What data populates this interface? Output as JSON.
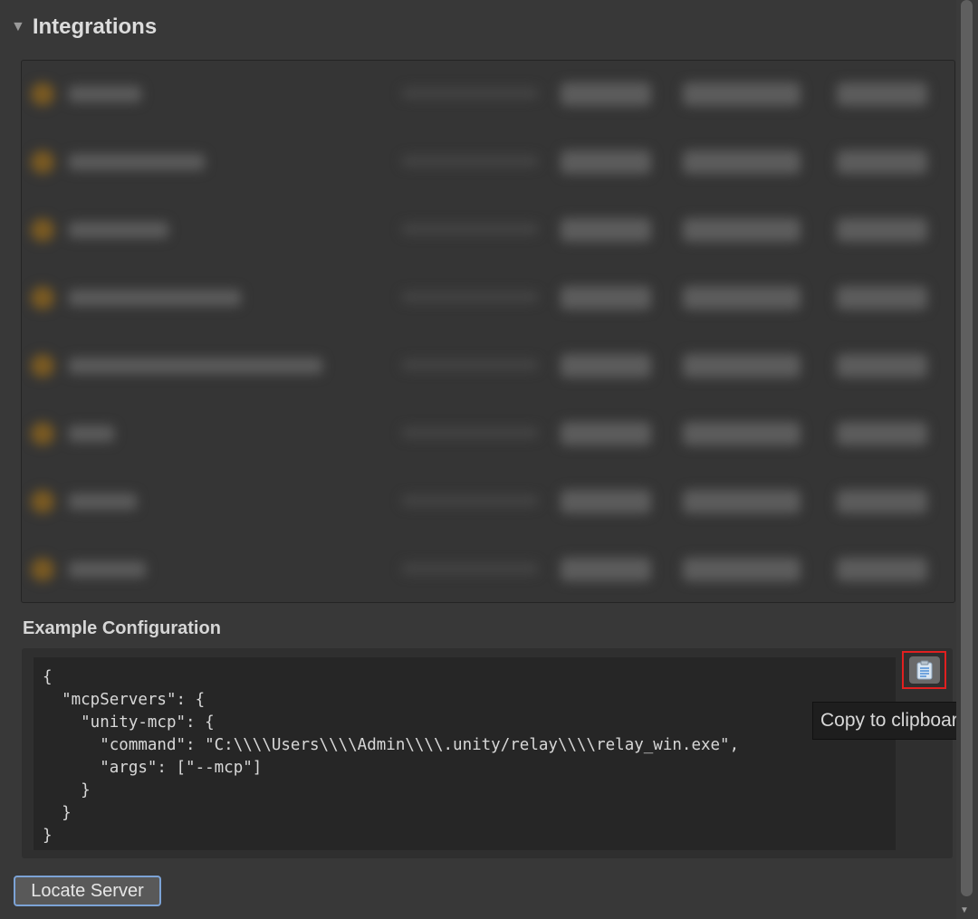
{
  "section": {
    "title": "Integrations",
    "triangle": "▼"
  },
  "integrations": {
    "rows": [
      {
        "label": "",
        "redacted": true
      },
      {
        "label": "",
        "redacted": true
      },
      {
        "label": "",
        "redacted": true
      },
      {
        "label": "",
        "redacted": true
      },
      {
        "label": "",
        "redacted": true
      },
      {
        "label": "",
        "redacted": true
      },
      {
        "label": "",
        "redacted": true
      },
      {
        "label": "",
        "redacted": true
      }
    ]
  },
  "example": {
    "label": "Example Configuration",
    "code": "{\n  \"mcpServers\": {\n    \"unity-mcp\": {\n      \"command\": \"C:\\\\\\\\Users\\\\\\\\Admin\\\\\\\\.unity/relay\\\\\\\\relay_win.exe\",\n      \"args\": [\"--mcp\"]\n    }\n  }\n}"
  },
  "copy": {
    "icon": "clipboard-icon",
    "tooltip": "Copy to clipboard"
  },
  "locate_button": {
    "label": "Locate Server"
  },
  "colors": {
    "accent_border": "#7ca3d6",
    "highlight": "#e02020",
    "background": "#383838"
  }
}
